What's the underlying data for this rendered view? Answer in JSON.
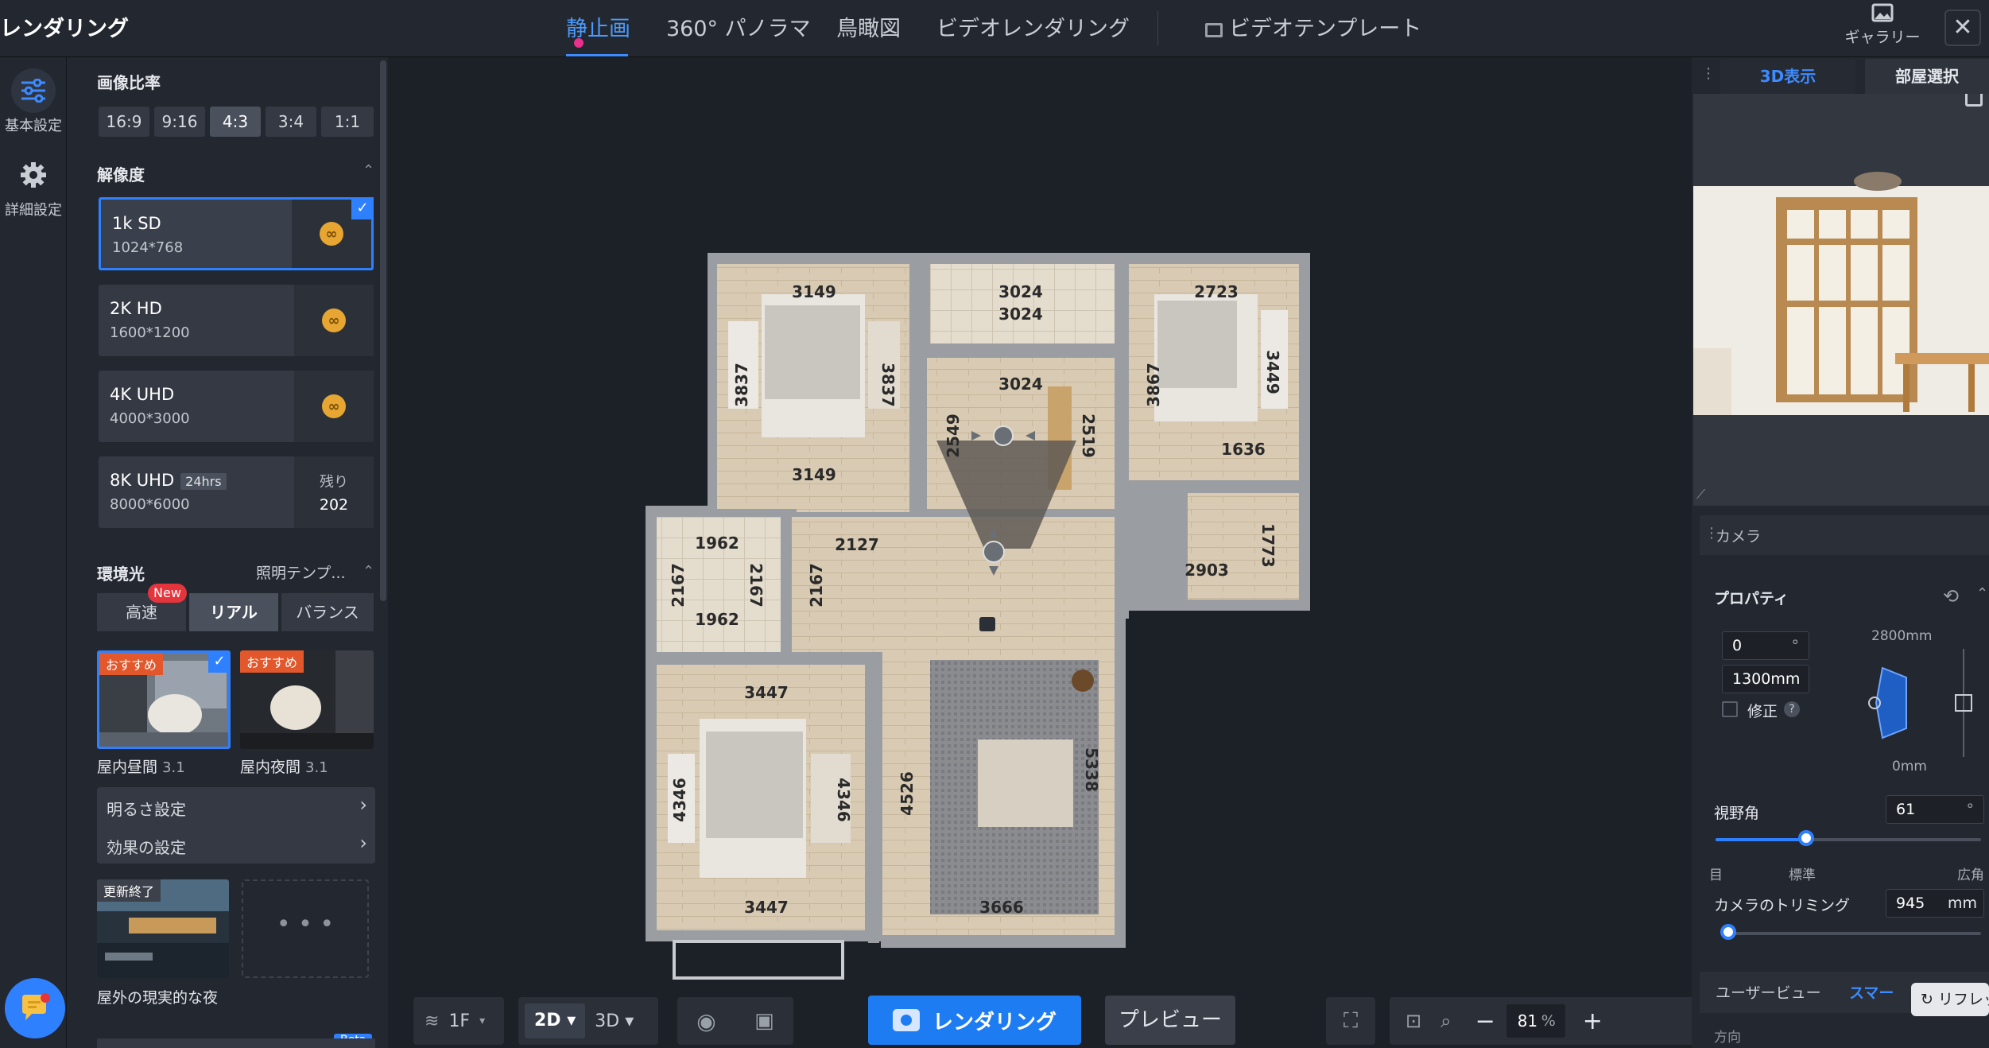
{
  "app": {
    "title": "レンダリング"
  },
  "top_tabs": [
    {
      "label": "静止画",
      "active": true
    },
    {
      "label": "360° パノラマ"
    },
    {
      "label": "鳥瞰図"
    },
    {
      "label": "ビデオレンダリング"
    },
    {
      "label": "ビデオテンプレート"
    }
  ],
  "gallery": {
    "label": "ギャラリー"
  },
  "rail": [
    {
      "label": "基本設定",
      "icon": "sliders-icon",
      "active": true
    },
    {
      "label": "詳細設定",
      "icon": "gear-icon"
    }
  ],
  "aspect": {
    "title": "画像比率",
    "options": [
      "16:9",
      "9:16",
      "4:3",
      "3:4",
      "1:1"
    ],
    "selected": "4:3"
  },
  "resolution": {
    "title": "解像度",
    "options": [
      {
        "name": "1k SD",
        "dims": "1024*768",
        "selected": true
      },
      {
        "name": "2K HD",
        "dims": "1600*1200"
      },
      {
        "name": "4K UHD",
        "dims": "4000*3000"
      },
      {
        "name": "8K UHD",
        "tag": "24hrs",
        "dims": "8000*6000",
        "remain_label": "残り",
        "remain_value": "202"
      }
    ]
  },
  "lighting": {
    "title": "環境光",
    "template_link": "照明テンプ...",
    "modes": [
      "高速",
      "リアル",
      "バランス"
    ],
    "selected": "リアル",
    "new_badge": "New",
    "presets": [
      {
        "badge": "おすすめ",
        "name": "屋内昼間",
        "version": "3.1",
        "selected": true
      },
      {
        "badge": "おすすめ",
        "name": "屋内夜間",
        "version": "3.1"
      }
    ],
    "menu": [
      "明るさ設定",
      "効果の設定"
    ],
    "scene": {
      "badge": "更新終了",
      "name": "屋外の現実的な夜"
    },
    "more": "• • •",
    "beta": "Beta"
  },
  "plan_labels": [
    {
      "id": "d1",
      "text": "3149"
    },
    {
      "id": "d2",
      "text": "3837"
    },
    {
      "id": "d3",
      "text": "3837"
    },
    {
      "id": "d4",
      "text": "3149"
    },
    {
      "id": "d5",
      "text": "3024"
    },
    {
      "id": "d6",
      "text": "3024"
    },
    {
      "id": "d7",
      "text": "3024"
    },
    {
      "id": "d8",
      "text": "2549"
    },
    {
      "id": "d9",
      "text": "2519"
    },
    {
      "id": "d10",
      "text": "2723"
    },
    {
      "id": "d11",
      "text": "3867"
    },
    {
      "id": "d12",
      "text": "3449"
    },
    {
      "id": "d13",
      "text": "1636"
    },
    {
      "id": "d14",
      "text": "1962"
    },
    {
      "id": "d15",
      "text": "2167"
    },
    {
      "id": "d16",
      "text": "2167"
    },
    {
      "id": "d17",
      "text": "1962"
    },
    {
      "id": "d18",
      "text": "2167"
    },
    {
      "id": "d19",
      "text": "2127"
    },
    {
      "id": "d20",
      "text": "2903"
    },
    {
      "id": "d21",
      "text": "1773"
    },
    {
      "id": "d22",
      "text": "3447"
    },
    {
      "id": "d23",
      "text": "4346"
    },
    {
      "id": "d24",
      "text": "4346"
    },
    {
      "id": "d25",
      "text": "3447"
    },
    {
      "id": "d26",
      "text": "4526"
    },
    {
      "id": "d27",
      "text": "5338"
    },
    {
      "id": "d28",
      "text": "3666"
    }
  ],
  "bottom_toolbar": {
    "floor": "1F",
    "view2d": "2D",
    "view3d": "3D",
    "render": "レンダリング",
    "preview": "プレビュー",
    "zoom_value": "81",
    "zoom_unit": "%"
  },
  "right_panel": {
    "tabs": [
      "3D表示",
      "部屋選択"
    ],
    "active_tab": "3D表示",
    "camera_title": "カメラ",
    "properties_title": "プロパティ",
    "angle_value": "0",
    "angle_unit": "°",
    "height_value": "1300mm",
    "correct_label": "修正",
    "height_max": "2800mm",
    "height_min": "0mm",
    "fov_label": "視野角",
    "fov_value": "61",
    "fov_unit": "°",
    "fov_fraction": 0.34,
    "fov_ticks": [
      "目",
      "標準",
      "広角"
    ],
    "clip_label": "カメラのトリミング",
    "clip_value": "945",
    "clip_unit": "mm",
    "clip_fraction": 0.02,
    "view_tabs": [
      "ユーザービュー",
      "スマー"
    ],
    "refresh": "リフレッ",
    "cut_text": "方向"
  },
  "colors": {
    "accent": "#2f80ff",
    "bg": "#1c2027",
    "panel": "#23272f"
  }
}
